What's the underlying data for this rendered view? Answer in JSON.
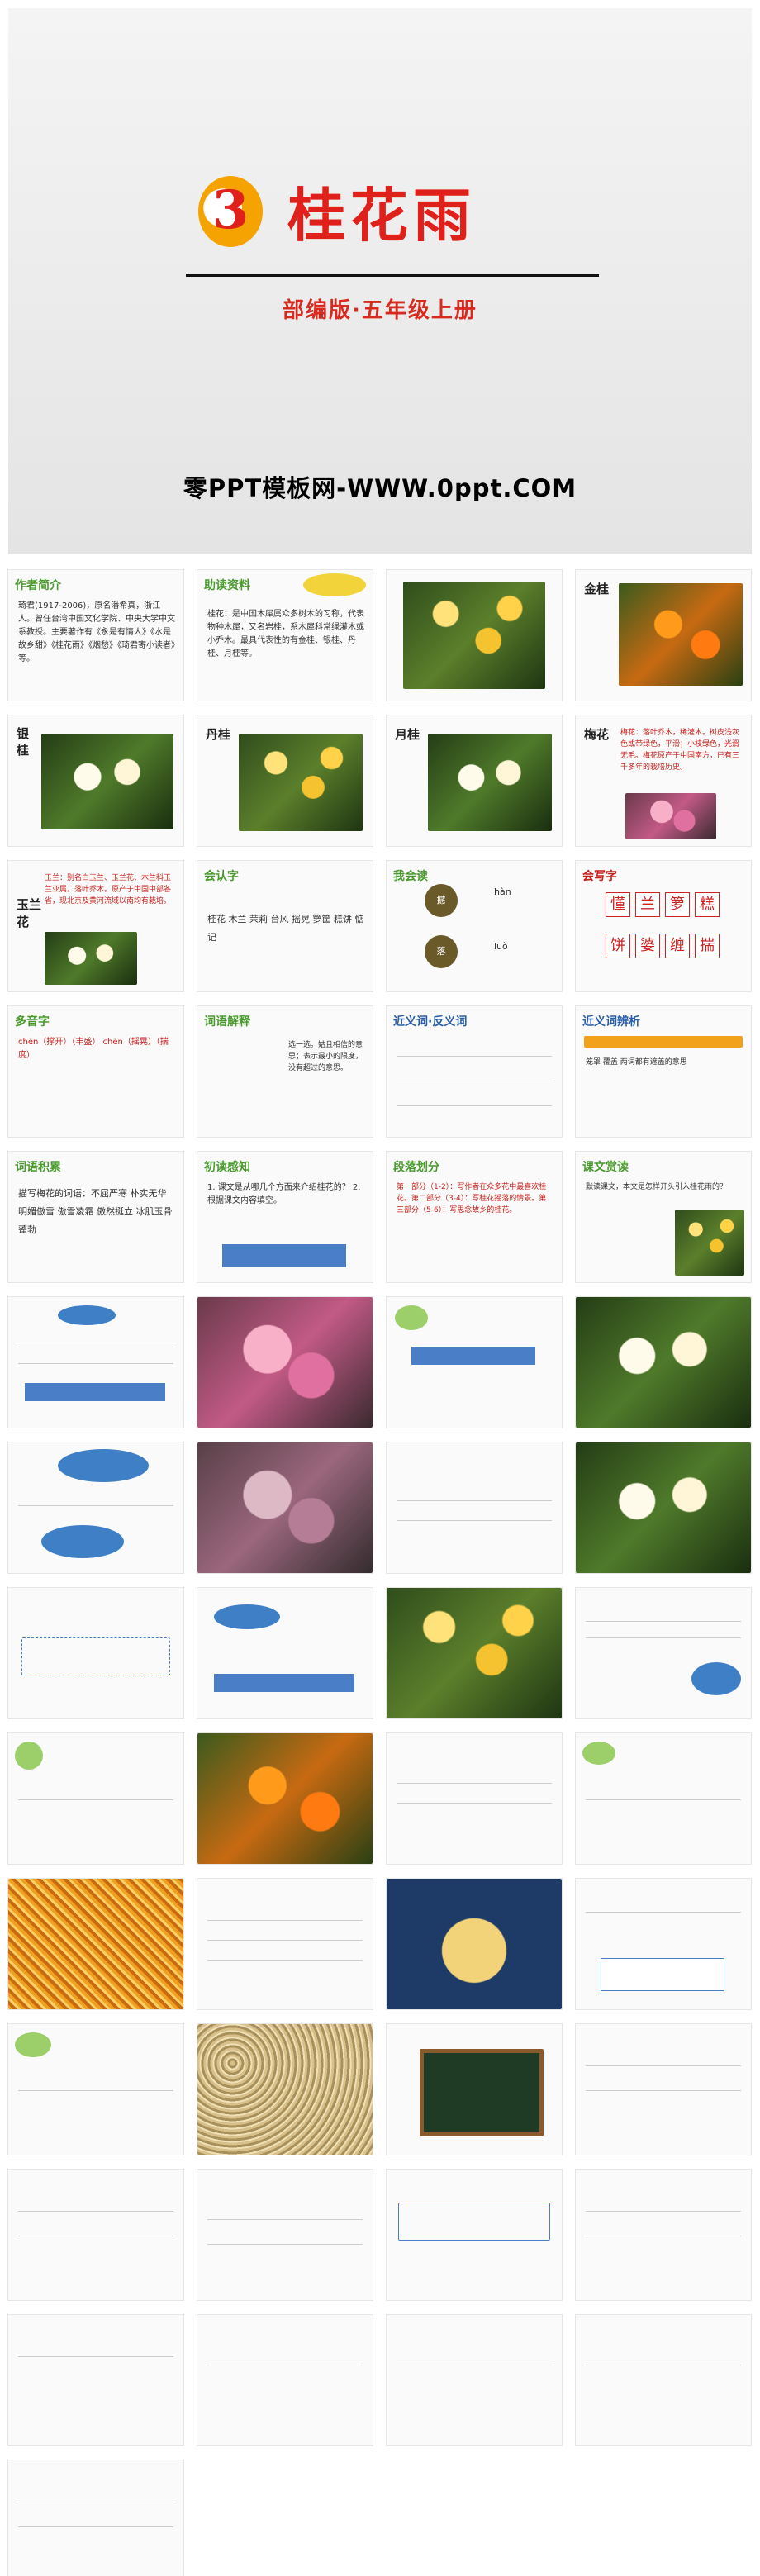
{
  "cover": {
    "lesson_number": "3",
    "title": "桂花雨",
    "subtitle": "部编版·五年级上册",
    "watermark": "零PPT模板网-WWW.0ppt.COM"
  },
  "slides": [
    {
      "id": "author",
      "heading": "作者简介",
      "body": "琦君(1917-2006)，原名潘希真，浙江人。曾任台湾中国文化学院、中央大学中文系教授。主要著作有《永是有情人》《水是故乡甜》《桂花雨》《烟愁》《琦君寄小读者》等。"
    },
    {
      "id": "resource",
      "heading": "助读资料",
      "body": "桂花：是中国木犀属众多树木的习称，代表物种木犀，又名岩桂，系木犀科常绿灌木或小乔木。最具代表性的有金桂、银桂、丹桂、月桂等。"
    },
    {
      "id": "img1",
      "label": ""
    },
    {
      "id": "jingui",
      "label": "金桂"
    },
    {
      "id": "yingui",
      "label": "银桂"
    },
    {
      "id": "dangui",
      "label": "丹桂"
    },
    {
      "id": "yuegui",
      "label": "月桂"
    },
    {
      "id": "meihua",
      "label": "梅花",
      "body": "梅花：落叶乔木，稀灌木。树皮浅灰色或带绿色，平滑；小枝绿色，光滑无毛。梅花原产于中国南方，已有三千多年的栽培历史。"
    },
    {
      "id": "yulan",
      "label": "玉兰花",
      "body": "玉兰：别名白玉兰、玉兰花、木兰科玉兰亚属，落叶乔木。原产于中国中部各省，现北京及黄河流域以南均有栽培。"
    },
    {
      "id": "huirendu",
      "heading": "会认字",
      "body": "桂花 木兰 茉莉 台风 摇晃 箩筐 糕饼 惦记"
    },
    {
      "id": "huidu",
      "heading": "我会读",
      "pinyin1": "hàn",
      "pinyin2": "luò"
    },
    {
      "id": "huixie",
      "heading": "会写字",
      "chars": [
        "懂",
        "兰",
        "箩",
        "糕",
        "饼",
        "婆",
        "缠",
        "箩",
        "揣"
      ]
    },
    {
      "id": "duoyin",
      "heading": "多音字",
      "body": "chēn（撑开）（丰盛） chēn（摇晃）（揣度）"
    },
    {
      "id": "ciyu",
      "heading": "词语解释",
      "body": "选一选。姑且相信的意思；表示最小的限度，没有超过的意思。"
    },
    {
      "id": "jinfan",
      "heading": "近义词·反义词",
      "body": "近义词 反义词"
    },
    {
      "id": "jinyi",
      "heading": "近义词辨析",
      "body": "笼罩 覆盖 两词都有遮盖的意思"
    },
    {
      "id": "cihui",
      "heading": "词语积累",
      "body": "描写梅花的词语：不屈严寒 朴实无华 明媚傲雪 傲雪凌霜 傲然挺立 冰肌玉骨 蓬勃"
    },
    {
      "id": "chudu",
      "heading": "初读感知",
      "body": "1. 课文是从哪几个方面来介绍桂花的？ 2. 根据课文内容填空。"
    },
    {
      "id": "duanluo",
      "heading": "段落划分",
      "body": "第一部分（1-2）：写作者在众多花中最喜欢桂花。第二部分（3-4）：写桂花摇落的情景。第三部分（5-6）：写思念故乡的桂花。"
    },
    {
      "id": "jingdu",
      "heading": "课文赏读",
      "body": "默读课文，本文是怎样开头引入桂花雨的？"
    }
  ]
}
